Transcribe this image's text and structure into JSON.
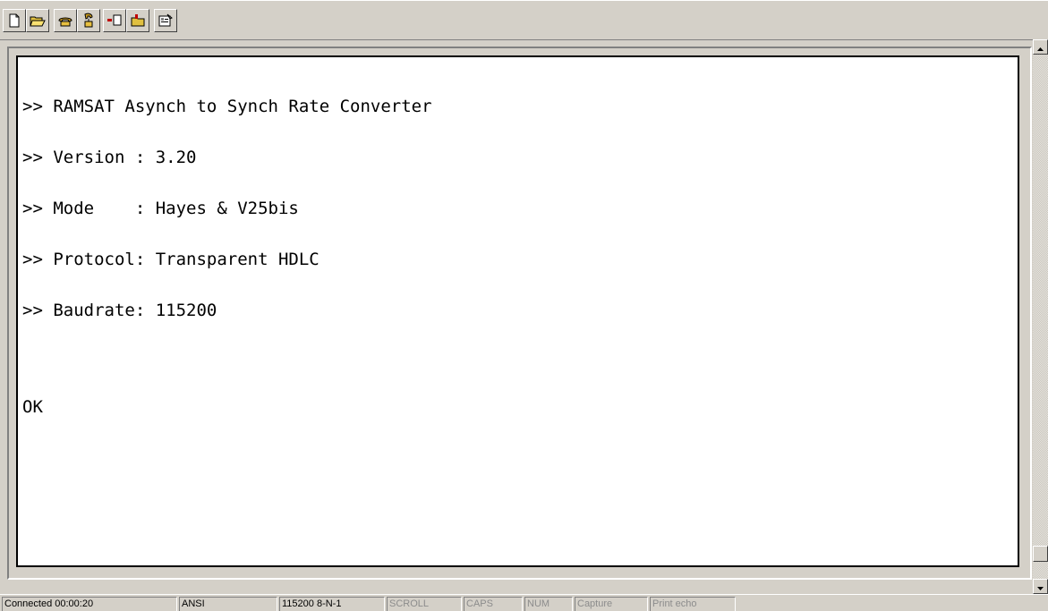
{
  "toolbar": {
    "buttons": [
      {
        "icon": "new-document-icon"
      },
      {
        "icon": "open-folder-icon"
      },
      {
        "icon": "connect-phone-icon"
      },
      {
        "icon": "disconnect-phone-icon"
      },
      {
        "icon": "send-file-icon"
      },
      {
        "icon": "receive-file-icon"
      },
      {
        "icon": "properties-icon"
      }
    ]
  },
  "terminal": {
    "lines": [
      ">> RAMSAT Asynch to Synch Rate Converter",
      ">> Version : 3.20",
      ">> Mode    : Hayes & V25bis",
      ">> Protocol: Transparent HDLC",
      ">> Baudrate: 115200",
      "",
      "OK"
    ]
  },
  "statusbar": {
    "connected": "Connected 00:00:20",
    "emulation": "ANSI",
    "port_settings": "115200 8-N-1",
    "scroll": "SCROLL",
    "caps": "CAPS",
    "num": "NUM",
    "capture": "Capture",
    "print_echo": "Print echo"
  },
  "colors": {
    "face": "#d4d0c8",
    "terminal_bg": "#ffffff",
    "dim_text": "#8c8c8c"
  }
}
